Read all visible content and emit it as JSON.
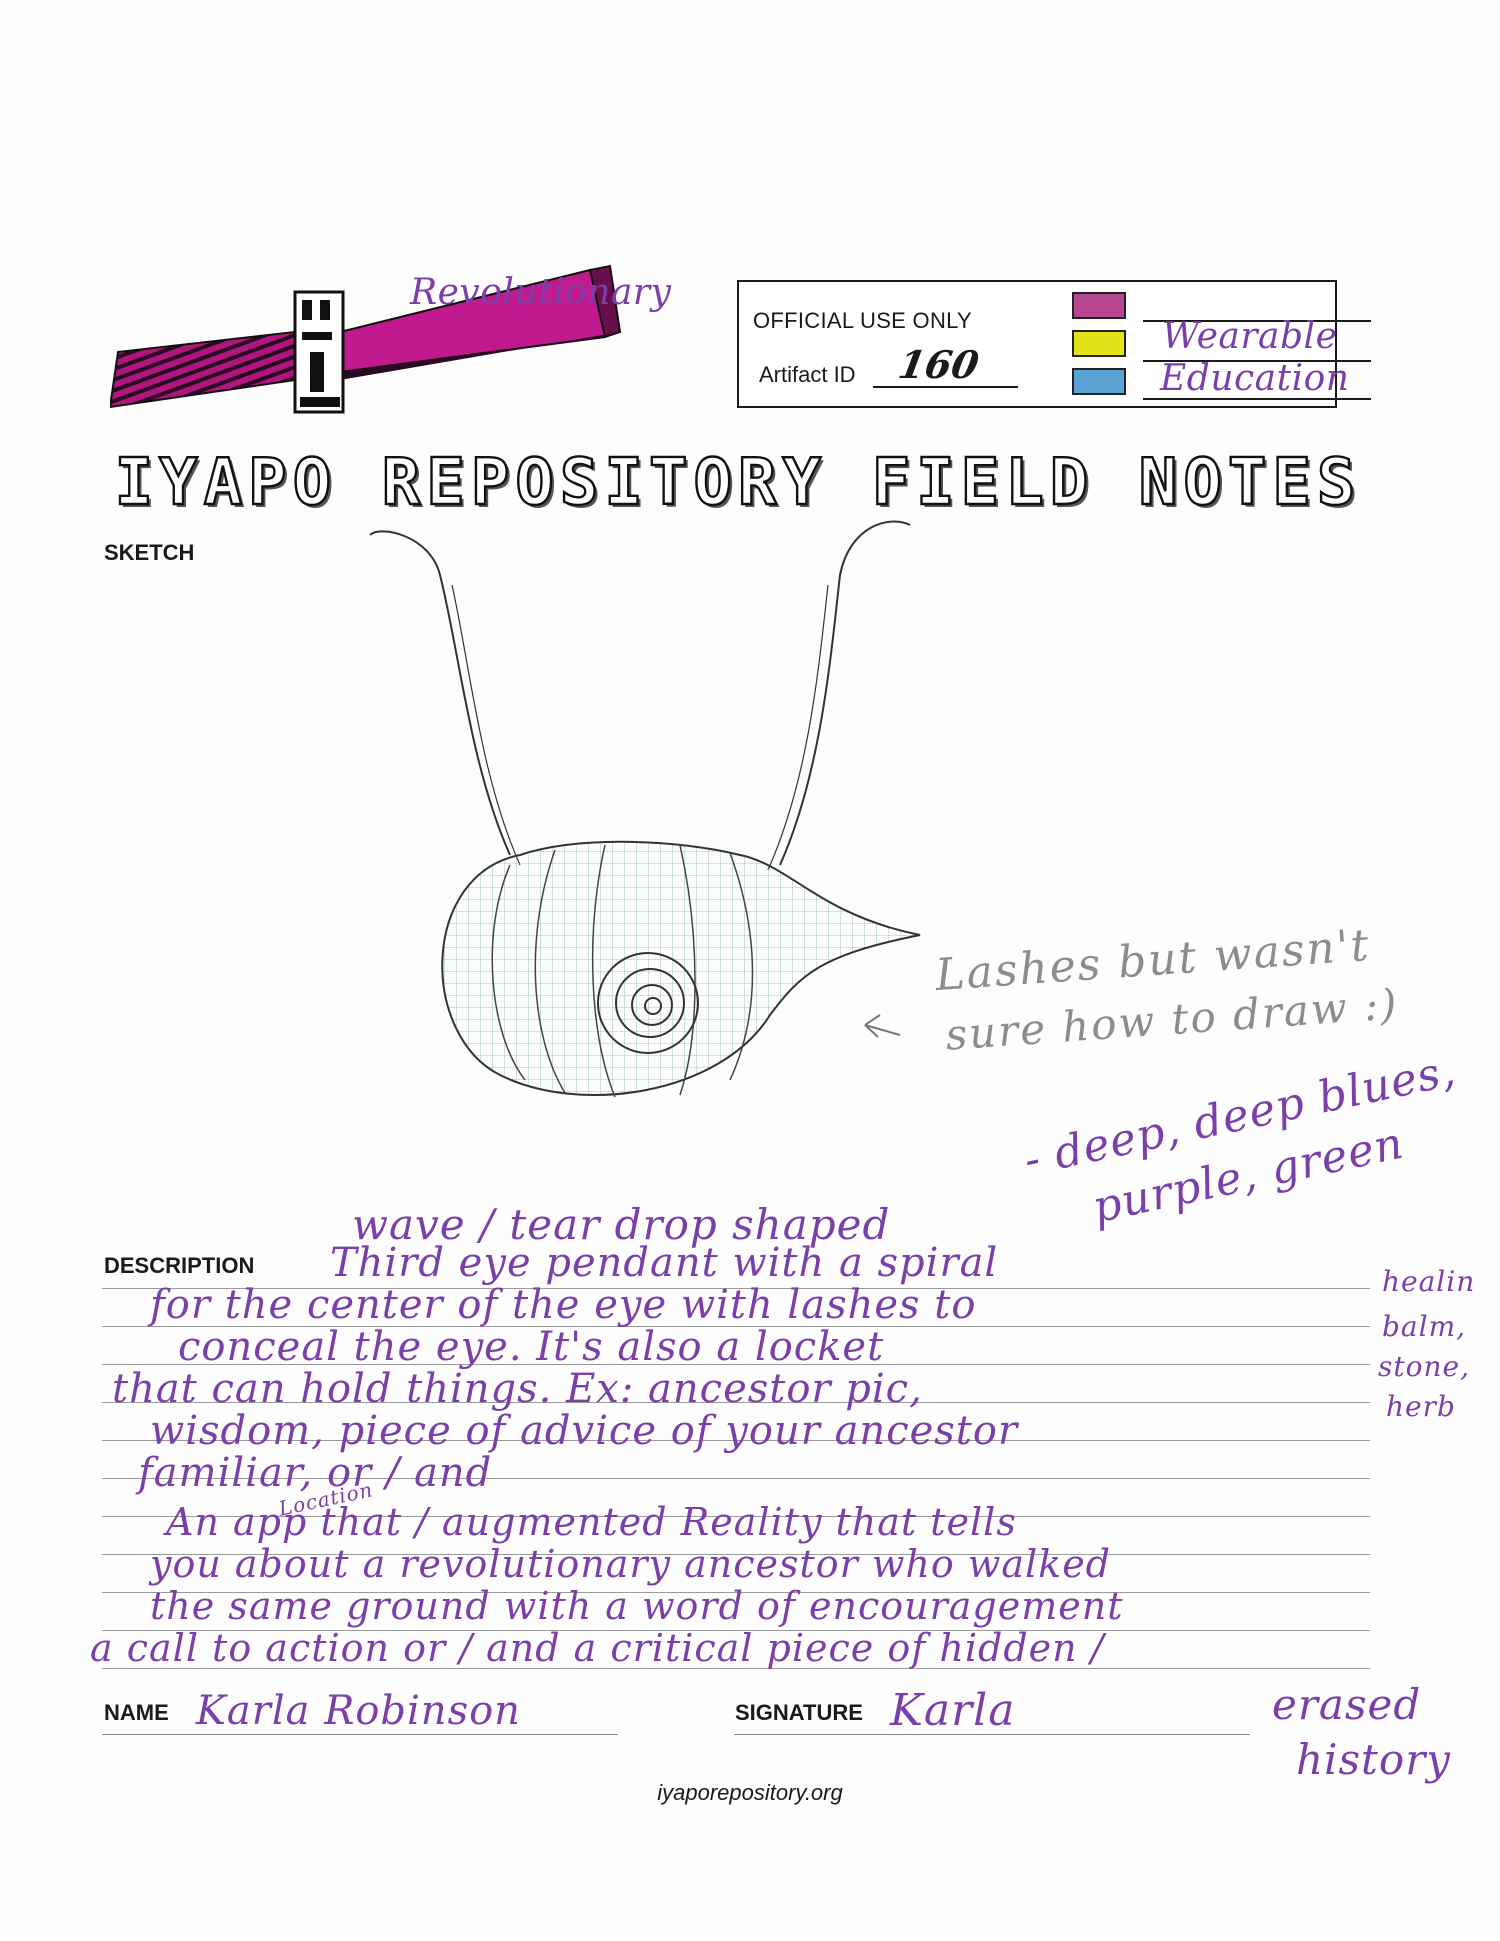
{
  "logo_brand": "IYAPO",
  "official": {
    "label": "OFFICIAL USE ONLY",
    "artifact_id_label": "Artifact ID",
    "artifact_id_value": "160",
    "categories": [
      {
        "label": "Revolutionary",
        "color": "#b5468f"
      },
      {
        "label": "Wearable",
        "color": "#e3e31a"
      },
      {
        "label": "Education",
        "color": "#5aa3d4"
      }
    ]
  },
  "title": "IYAPO REPOSITORY FIELD NOTES",
  "sketch": {
    "heading": "SKETCH",
    "annotation_line1": "Lashes but wasn't",
    "annotation_line2": "sure how to draw :)"
  },
  "description": {
    "heading": "DESCRIPTION",
    "color_note_line1": "- deep, deep blues,",
    "color_note_line2": "purple, green",
    "shape_note": "wave / tear drop shaped",
    "lines": [
      "Third eye pendant with a spiral",
      "for the center of the eye with lashes to",
      "conceal the eye. It's also a locket",
      "that can hold things. Ex: ancestor pic,",
      "wisdom, piece of advice of your ancestor",
      "familiar, or / and",
      "An app that / augmented Reality that tells",
      "you about a revolutionary ancestor who walked",
      "the same ground with a word of encouragement",
      "a call to action or / and a critical piece of hidden /"
    ],
    "location_note": "Location",
    "side_note": [
      "healin",
      "balm,",
      "stone,",
      "herb"
    ],
    "trailing_note": [
      "erased",
      "history"
    ]
  },
  "name": {
    "label": "NAME",
    "value": "Karla Robinson"
  },
  "signature": {
    "label": "SIGNATURE",
    "value": "Karla"
  },
  "footer": "iyaporepository.org"
}
